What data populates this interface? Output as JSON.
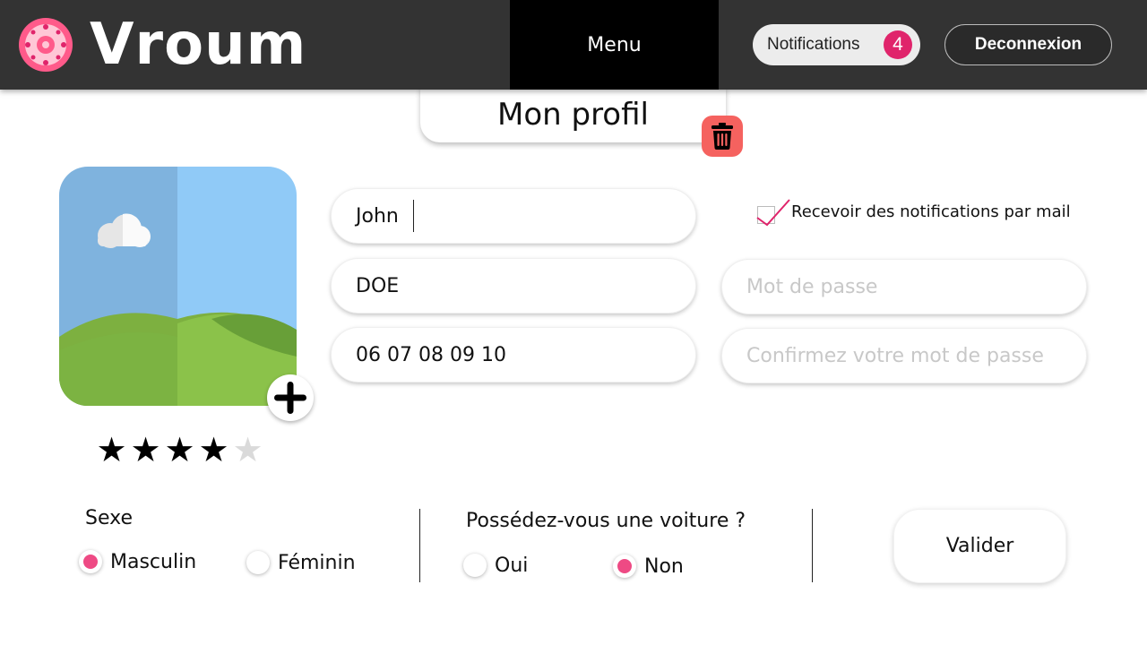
{
  "header": {
    "brand": "Vroum",
    "menu_label": "Menu",
    "notifications_label": "Notifications",
    "notifications_count": "4",
    "logout_label": "Deconnexion"
  },
  "page": {
    "title": "Mon profil"
  },
  "profile": {
    "rating": 4,
    "rating_max": 5,
    "first_name": "John",
    "last_name": "DOE",
    "phone": "06 07 08 09 10",
    "password_placeholder": "Mot de passe",
    "confirm_password_placeholder": "Confirmez votre mot de passe",
    "email_notifications_label": "Recevoir des notifications par mail",
    "email_notifications_checked": true
  },
  "gender": {
    "label": "Sexe",
    "options": [
      "Masculin",
      "Féminin"
    ],
    "selected": "Masculin"
  },
  "car": {
    "label": "Possédez-vous une voiture ?",
    "options": [
      "Oui",
      "Non"
    ],
    "selected": "Non"
  },
  "submit_label": "Valider",
  "colors": {
    "header_bg": "#333333",
    "menu_bg": "#000000",
    "accent": "#e0246b",
    "radio_selected": "#ee4a84",
    "delete_bg": "#f5625f"
  }
}
